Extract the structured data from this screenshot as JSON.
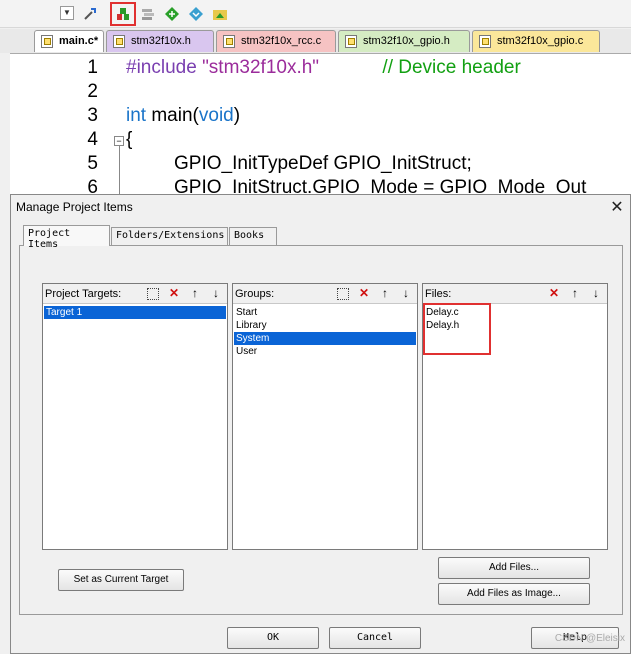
{
  "toolbar": {
    "dropdown_icon": "chevron-down",
    "icons": [
      "build-tools-icon",
      "manage-project-items-icon",
      "stack-icon",
      "diamond-green-icon",
      "diamond-blue-icon",
      "folder-image-icon"
    ]
  },
  "tabs": [
    {
      "label": "main.c*",
      "color": "#ffffff",
      "active": true
    },
    {
      "label": "stm32f10x.h",
      "color": "#d9c6ef"
    },
    {
      "label": "stm32f10x_rcc.c",
      "color": "#f6c3c3"
    },
    {
      "label": "stm32f10x_gpio.h",
      "color": "#d5ecc3"
    },
    {
      "label": "stm32f10x_gpio.c",
      "color": "#fbe79a"
    }
  ],
  "editor": {
    "line_numbers": [
      "1",
      "2",
      "3",
      "4",
      "5",
      "6"
    ],
    "line1": {
      "directive": "#include",
      "string": "\"stm32f10x.h\"",
      "comment": "// Device header"
    },
    "line3": {
      "type": "int",
      "name": "main(",
      "arg": "void",
      "close": ")"
    },
    "line4": "{",
    "line5": "GPIO_InitTypeDef GPIO_InitStruct;",
    "line6": "GPIO_InitStruct.GPIO_Mode = GPIO_Mode_Out"
  },
  "dialog": {
    "title": "Manage Project Items",
    "close": "✕",
    "tabs": [
      "Project Items",
      "Folders/Extensions",
      "Books"
    ],
    "targets": {
      "label": "Project Targets:",
      "items": [
        "Target 1"
      ]
    },
    "groups": {
      "label": "Groups:",
      "items": [
        "Start",
        "Library",
        "System",
        "User"
      ]
    },
    "files": {
      "label": "Files:",
      "items": [
        "Delay.c",
        "Delay.h"
      ]
    },
    "buttons": {
      "set_target": "Set as Current Target",
      "add_files": "Add Files...",
      "add_files_image": "Add Files as Image...",
      "ok": "OK",
      "cancel": "Cancel",
      "help": "Help"
    }
  },
  "watermark": "CSDN @Eleisix"
}
